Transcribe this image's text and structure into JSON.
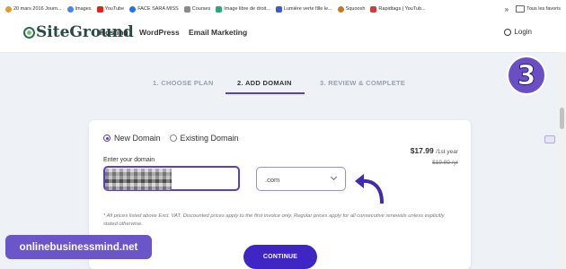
{
  "bookmarks": {
    "items": [
      {
        "label": "20 mars 2016 Journ...",
        "color": "#e39b2a"
      },
      {
        "label": "Images",
        "color": "#4285f4"
      },
      {
        "label": "YouTube",
        "color": "#e62117"
      },
      {
        "label": "FACE SARA MISS",
        "color": "#1877f2"
      },
      {
        "label": "Courses",
        "color": "#8a8a8a"
      },
      {
        "label": "Image libre de droit...",
        "color": "#2aa879"
      },
      {
        "label": "Lumière verte fille le...",
        "color": "#3b5bdb"
      },
      {
        "label": "Squoosh",
        "color": "#c7791f"
      },
      {
        "label": "Rapidtags | YouTub...",
        "color": "#d23a3a"
      }
    ],
    "overflow": "»",
    "other_folder": "Tous les favoris"
  },
  "header": {
    "logo": "SiteGround",
    "nav": [
      "Hosting",
      "WordPress",
      "Email Marketing"
    ],
    "login": "Login"
  },
  "overlay_badge": "3",
  "steps": [
    "1. CHOOSE PLAN",
    "2. ADD DOMAIN",
    "3. REVIEW & COMPLETE"
  ],
  "active_step": 2,
  "domain_form": {
    "option_new": "New Domain",
    "option_existing": "Existing Domain",
    "selected_option": "New Domain",
    "input_label": "Enter your domain",
    "tld": ".com",
    "price": "$17.99",
    "price_period": "/1st year",
    "old_price": "$19.99 /yr",
    "disclaimer": "* All prices listed above Excl. VAT. Discounted prices apply to the first invoice only. Regular prices apply for all consecutive renewals unless explicitly stated otherwise.",
    "continue_label": "CONTINUE"
  },
  "watermark": "onlinebusinessmind.net",
  "colors": {
    "accent": "#5a3fc6",
    "button": "#3f25c4",
    "badge": "#6a4fc4"
  }
}
